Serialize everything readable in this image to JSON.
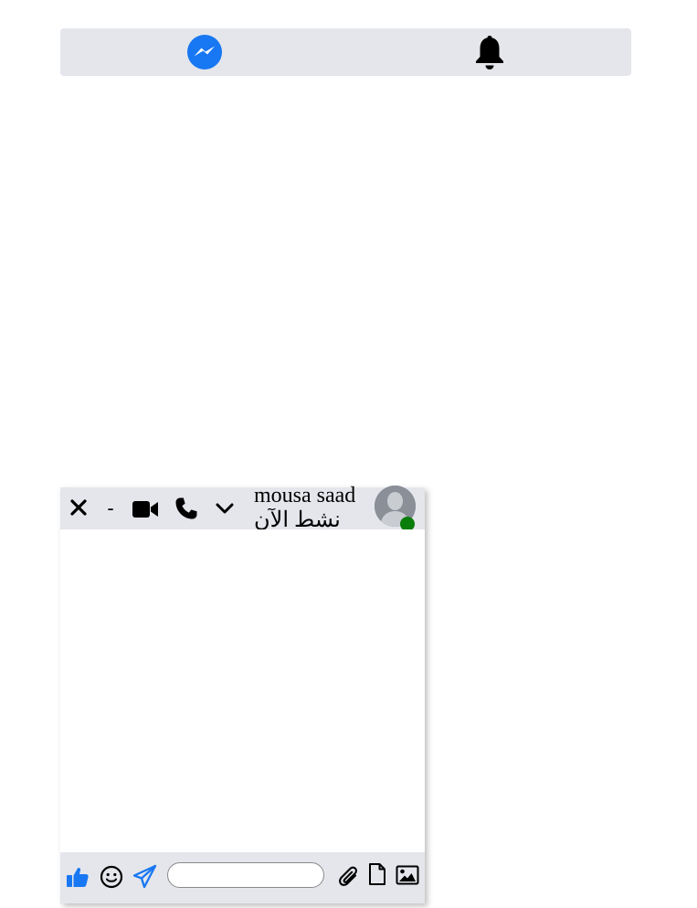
{
  "topbar": {
    "icons": [
      "messenger-icon",
      "bell-icon"
    ],
    "messenger_color": "#1877f2"
  },
  "chat": {
    "contact": {
      "name": "mousa saad",
      "status": "نشط الآن",
      "online": true,
      "online_color": "#0a7d0a"
    },
    "header_actions": {
      "close": "close-icon",
      "minimize_label": "-",
      "video": "video-camera-icon",
      "call": "phone-icon",
      "options": "chevron-down-icon"
    },
    "composer": {
      "message_value": "",
      "message_placeholder": "",
      "left_actions": [
        "thumbs-up-icon",
        "smile-icon",
        "paper-plane-icon"
      ],
      "right_actions": [
        "paperclip-icon",
        "file-icon",
        "image-icon"
      ],
      "accent_color": "#1877f2"
    }
  }
}
